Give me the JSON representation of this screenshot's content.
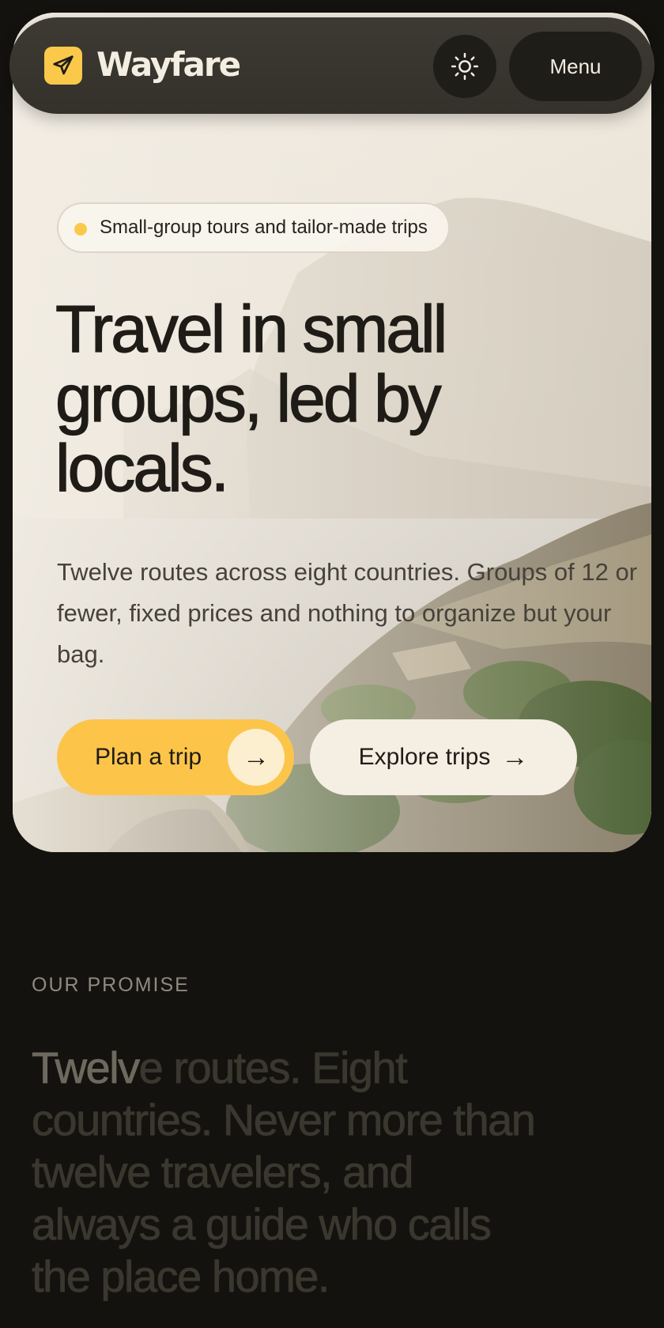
{
  "header": {
    "brand": "Wayfare",
    "logo_icon": "paper-plane-icon",
    "theme_icon": "sun-icon",
    "menu_label": "Menu"
  },
  "hero": {
    "badge": "Small-group tours and tailor-made trips",
    "headline_lines": [
      "Travel in small",
      "groups, led by",
      "locals."
    ],
    "lede": "Twelve routes across eight countries. Groups of 12 or fewer, fixed prices and nothing to organize but your bag.",
    "primary_cta": "Plan a trip",
    "secondary_cta": "Explore trips",
    "arrow": "→"
  },
  "promise": {
    "eyebrow": "OUR PROMISE",
    "text_highlighted": "Twelv",
    "text_rest": "e routes. Eight countries. Never more than twelve travelers, and always a guide who calls the place home."
  },
  "colors": {
    "accent": "#fcc54a",
    "page_bg": "#13120e",
    "header_bg": "#3a3731",
    "ink": "#1f1c17"
  }
}
